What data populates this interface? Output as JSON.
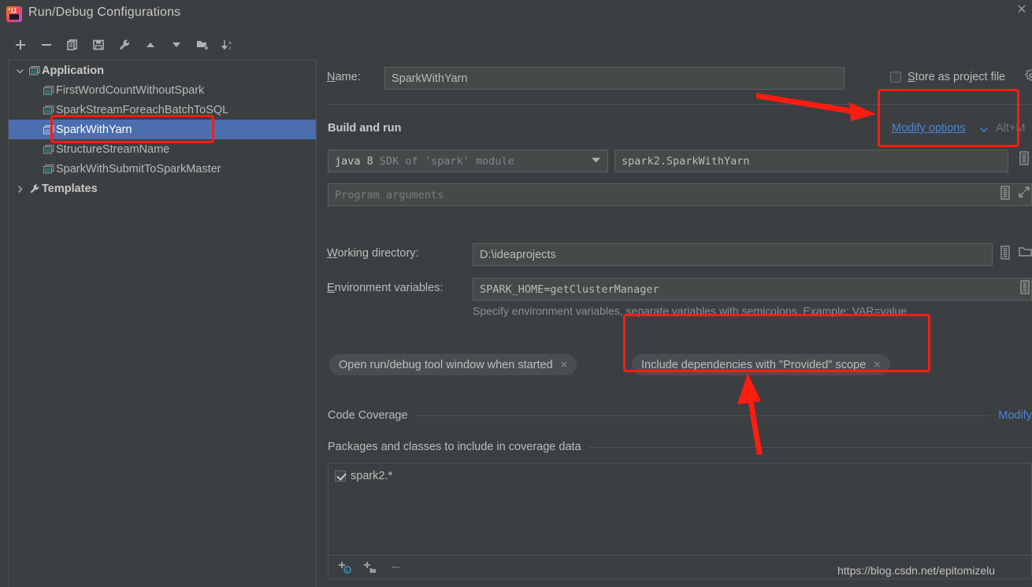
{
  "window": {
    "title": "Run/Debug Configurations",
    "app_icon": "intellij-idea-icon",
    "close_label": "×"
  },
  "toolbar": {
    "buttons": [
      {
        "name": "add-configuration-button",
        "label": "+",
        "icon": "plus-icon"
      },
      {
        "name": "remove-configuration-button",
        "label": "−",
        "icon": "minus-icon"
      },
      {
        "name": "copy-configuration-button",
        "label": "Copy",
        "icon": "copy-icon"
      },
      {
        "name": "save-configuration-button",
        "label": "Save",
        "icon": "save-icon"
      },
      {
        "name": "edit-templates-button",
        "label": "Edit Templates",
        "icon": "wrench-icon"
      },
      {
        "name": "move-up-button",
        "label": "Move Up",
        "icon": "triangle-up-icon"
      },
      {
        "name": "move-down-button",
        "label": "Move Down",
        "icon": "triangle-down-icon"
      },
      {
        "name": "new-folder-button",
        "label": "New Folder",
        "icon": "folder-add-icon"
      },
      {
        "name": "sort-configurations-button",
        "label": "Sort",
        "icon": "sort-az-icon"
      }
    ]
  },
  "tree": {
    "nodes": [
      {
        "label": "Application",
        "level": 0,
        "expanded": true,
        "icon": "application-icon",
        "selected": false
      },
      {
        "label": "FirstWordCountWithoutSpark",
        "level": 1,
        "icon": "application-icon",
        "selected": false
      },
      {
        "label": "SparkStreamForeachBatchToSQL",
        "level": 1,
        "icon": "application-icon",
        "selected": false
      },
      {
        "label": "SparkWithYarn",
        "level": 1,
        "icon": "application-icon",
        "selected": true
      },
      {
        "label": "StructureStreamName",
        "level": 1,
        "icon": "application-icon",
        "selected": false
      },
      {
        "label": "SparkWithSubmitToSparkMaster",
        "level": 1,
        "icon": "application-icon",
        "selected": false
      },
      {
        "label": "Templates",
        "level": 0,
        "expanded": false,
        "icon": "wrench-icon",
        "selected": false
      }
    ]
  },
  "form": {
    "name_label": "Name:",
    "name_label_mnemonic": "N",
    "name_value": "SparkWithYarn",
    "store_as_project_file_label": "Store as project file",
    "store_as_project_file_mnemonic": "S",
    "store_as_project_file_checked": false,
    "store_gear_icon": "gear-icon",
    "build_and_run_label": "Build and run",
    "modify_options_label": "Modify options",
    "modify_options_mnemonic": "M",
    "modify_options_shortcut": "Alt+M",
    "modify_options_chevron": "chevron-down-icon",
    "sdk_value_strong": "java 8",
    "sdk_value_dim": "SDK of 'spark' module",
    "main_class_value": "spark2.SparkWithYarn",
    "program_arguments_placeholder": "Program arguments",
    "working_directory_label": "Working directory:",
    "working_directory_mnemonic": "W",
    "working_directory_value": "D:\\ideaprojects",
    "environment_variables_label": "Environment variables:",
    "environment_variables_mnemonic": "E",
    "environment_variables_value": "SPARK_HOME=getClusterManager",
    "environment_hint": "Specify environment variables, separate variables with semicolons. Example: VAR=value",
    "chips": [
      {
        "name": "chip-open-run-debug-tool-window",
        "label": "Open run/debug tool window when started",
        "close": "×"
      },
      {
        "name": "chip-include-provided-scope",
        "label": "Include dependencies with \"Provided\" scope",
        "close": "×"
      }
    ]
  },
  "code_coverage": {
    "section_title": "Code Coverage",
    "modify_link": "Modify",
    "packages_title": "Packages and classes to include in coverage data",
    "items": [
      {
        "label": "spark2.*",
        "checked": true
      }
    ],
    "buttons": [
      {
        "name": "add-class-button",
        "icon": "add-class-icon",
        "label": "Add class"
      },
      {
        "name": "add-package-button",
        "icon": "add-package-icon",
        "label": "Add package"
      },
      {
        "name": "remove-entry-button",
        "icon": "minus-icon",
        "label": "Remove"
      }
    ]
  },
  "annotations": {
    "watermark": "https://blog.csdn.net/epitomizelu",
    "highlight_color": "#fc1d10",
    "boxes": [
      {
        "name": "highlight-selected-config"
      },
      {
        "name": "highlight-modify-options"
      },
      {
        "name": "highlight-provided-scope-chip"
      }
    ]
  },
  "colors": {
    "background": "#3c3f41",
    "field_background": "#45494a",
    "selection": "#4b6eaf",
    "link": "#4e82d8",
    "text": "#bbbbbb",
    "muted_text": "#8b8f90",
    "border": "#4e5254",
    "annotation_red": "#fc1d10"
  }
}
